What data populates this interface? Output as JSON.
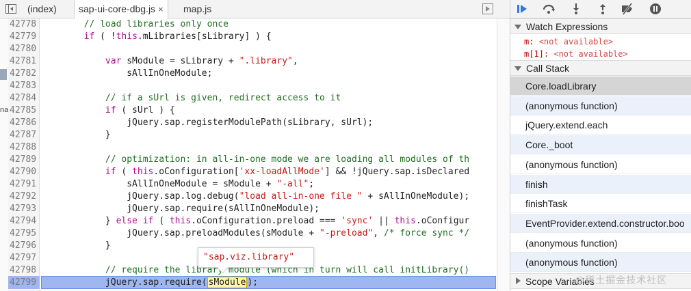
{
  "editor": {
    "tabs": [
      {
        "label": "(index)",
        "active": false
      },
      {
        "label": "sap-ui-core-dbg.js",
        "active": true,
        "close": "×"
      },
      {
        "label": "map.js",
        "active": false
      }
    ],
    "left_strip_text": "na",
    "lines": [
      {
        "num": "42778",
        "code": [
          {
            "t": "        "
          },
          {
            "t": "// load libraries only once",
            "c": "c"
          }
        ]
      },
      {
        "num": "42779",
        "code": [
          {
            "t": "        "
          },
          {
            "t": "if",
            "c": "k"
          },
          {
            "t": " ( !"
          },
          {
            "t": "this",
            "c": "k"
          },
          {
            "t": ".mLibraries[sLibrary] ) {"
          }
        ]
      },
      {
        "num": "42780",
        "code": []
      },
      {
        "num": "42781",
        "code": [
          {
            "t": "            "
          },
          {
            "t": "var",
            "c": "k"
          },
          {
            "t": " sModule = sLibrary + "
          },
          {
            "t": "\".library\"",
            "c": "s"
          },
          {
            "t": ","
          }
        ]
      },
      {
        "num": "42782",
        "code": [
          {
            "t": "                sAllInOneModule;"
          }
        ]
      },
      {
        "num": "42783",
        "code": []
      },
      {
        "num": "42784",
        "code": [
          {
            "t": "            "
          },
          {
            "t": "// if a sUrl is given, redirect access to it",
            "c": "c"
          }
        ]
      },
      {
        "num": "42785",
        "code": [
          {
            "t": "            "
          },
          {
            "t": "if",
            "c": "k"
          },
          {
            "t": " ( sUrl ) {"
          }
        ]
      },
      {
        "num": "42786",
        "code": [
          {
            "t": "                jQuery.sap.registerModulePath(sLibrary, sUrl);"
          }
        ]
      },
      {
        "num": "42787",
        "code": [
          {
            "t": "            }"
          }
        ]
      },
      {
        "num": "42788",
        "code": []
      },
      {
        "num": "42789",
        "code": [
          {
            "t": "            "
          },
          {
            "t": "// optimization: in all-in-one mode we are loading all modules of th",
            "c": "c"
          }
        ]
      },
      {
        "num": "42790",
        "code": [
          {
            "t": "            "
          },
          {
            "t": "if",
            "c": "k"
          },
          {
            "t": " ( "
          },
          {
            "t": "this",
            "c": "k"
          },
          {
            "t": ".oConfiguration["
          },
          {
            "t": "'xx-loadAllMode'",
            "c": "s"
          },
          {
            "t": "] && !jQuery.sap.isDeclared"
          }
        ]
      },
      {
        "num": "42791",
        "code": [
          {
            "t": "                sAllInOneModule = sModule + "
          },
          {
            "t": "\"-all\"",
            "c": "s"
          },
          {
            "t": ";"
          }
        ]
      },
      {
        "num": "42792",
        "code": [
          {
            "t": "                jQuery.sap.log.debug("
          },
          {
            "t": "\"load all-in-one file \"",
            "c": "s"
          },
          {
            "t": " + sAllInOneModule);"
          }
        ]
      },
      {
        "num": "42793",
        "code": [
          {
            "t": "                jQuery.sap.require(sAllInOneModule);"
          }
        ]
      },
      {
        "num": "42794",
        "code": [
          {
            "t": "            } "
          },
          {
            "t": "else if",
            "c": "k"
          },
          {
            "t": " ( "
          },
          {
            "t": "this",
            "c": "k"
          },
          {
            "t": ".oConfiguration.preload === "
          },
          {
            "t": "'sync'",
            "c": "s"
          },
          {
            "t": " || "
          },
          {
            "t": "this",
            "c": "k"
          },
          {
            "t": ".oConfigur"
          }
        ]
      },
      {
        "num": "42795",
        "code": [
          {
            "t": "                jQuery.sap.preloadModules(sModule + "
          },
          {
            "t": "\"-preload\"",
            "c": "s"
          },
          {
            "t": ", "
          },
          {
            "t": "/* force sync */",
            "c": "c"
          }
        ]
      },
      {
        "num": "42796",
        "code": [
          {
            "t": "            }"
          }
        ]
      },
      {
        "num": "42797",
        "code": []
      },
      {
        "num": "42798",
        "code": [
          {
            "t": "            "
          },
          {
            "t": "// require the library module (which in turn will call initLibrary()",
            "c": "c"
          }
        ]
      },
      {
        "num": "42799",
        "code": [
          {
            "t": "            jQuery.sap.require("
          },
          {
            "t": "sModule",
            "c": "hl"
          },
          {
            "t": ");"
          }
        ]
      }
    ],
    "tooltip": "\"sap.viz.library\""
  },
  "sidebar": {
    "watch": {
      "title": "Watch Expressions",
      "items": [
        {
          "name": "m",
          "value": "<not available>"
        },
        {
          "name": "m[1]",
          "value": "<not available>"
        }
      ]
    },
    "call_stack": {
      "title": "Call Stack",
      "frames": [
        "Core.loadLibrary",
        "(anonymous function)",
        "jQuery.extend.each",
        "Core._boot",
        "(anonymous function)",
        "finish",
        "finishTask",
        "EventProvider.extend.constructor.boo",
        "(anonymous function)",
        "(anonymous function)"
      ]
    },
    "scope": {
      "title": "Scope Variables"
    }
  },
  "watermark": "@稀土掘金技术社区",
  "colors": {
    "execution_line": "#9fb6f0",
    "keyword": "#aa0d91",
    "comment": "#236e25",
    "string": "#c41a16"
  }
}
